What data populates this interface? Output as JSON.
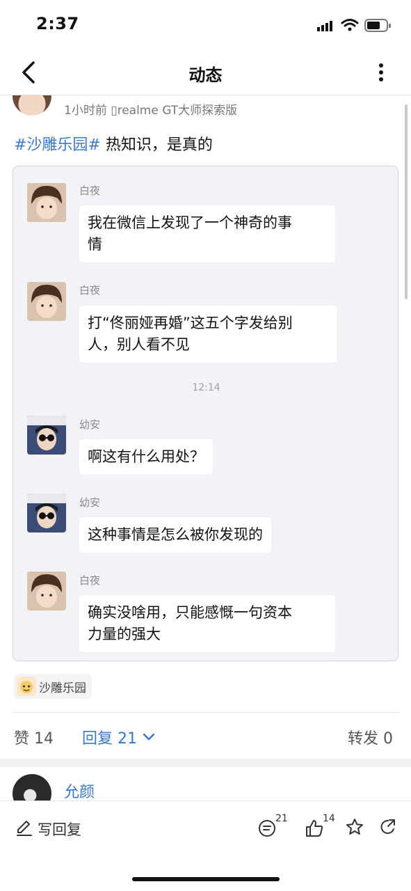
{
  "status_bar": {
    "time": "2:37"
  },
  "nav": {
    "title": "动态"
  },
  "post": {
    "meta": "1小时前  ▯realme GT大师探索版",
    "hashtag": "#沙雕乐园#",
    "text": " 热知识，是真的"
  },
  "chat": {
    "messages": [
      {
        "name": "白夜",
        "lines": [
          "我在微信上发现了一个神奇的事",
          "情"
        ]
      },
      {
        "name": "白夜",
        "lines": [
          "打“佟丽娅再婚”这五个字发给别",
          "人，别人看不见"
        ]
      },
      {
        "time": "12:14"
      },
      {
        "name": "幼安",
        "lines": [
          "啊这有什么用处？"
        ]
      },
      {
        "name": "幼安",
        "lines": [
          "这种事情是怎么被你发现的"
        ]
      },
      {
        "name": "白夜",
        "lines": [
          "确实没啥用，只能感慨一句资本",
          "力量的强大"
        ]
      }
    ]
  },
  "topic": {
    "label": "沙雕乐园"
  },
  "stats": {
    "likes": "赞 14",
    "replies": "回复 21",
    "reposts": "转发 0"
  },
  "comment_preview": {
    "name": "允颜"
  },
  "bottom_bar": {
    "reply_label": "写回复",
    "comment_count": "21",
    "like_count": "14"
  },
  "colors": {
    "link_blue": "#3b78c7",
    "chat_bg": "#f2f3f6"
  },
  "icons": [
    "back-arrow-icon",
    "more-vertical-icon",
    "phone-icon",
    "chevron-down-icon",
    "pencil-icon",
    "comment-icon",
    "thumbs-up-icon",
    "star-icon",
    "share-icon"
  ]
}
